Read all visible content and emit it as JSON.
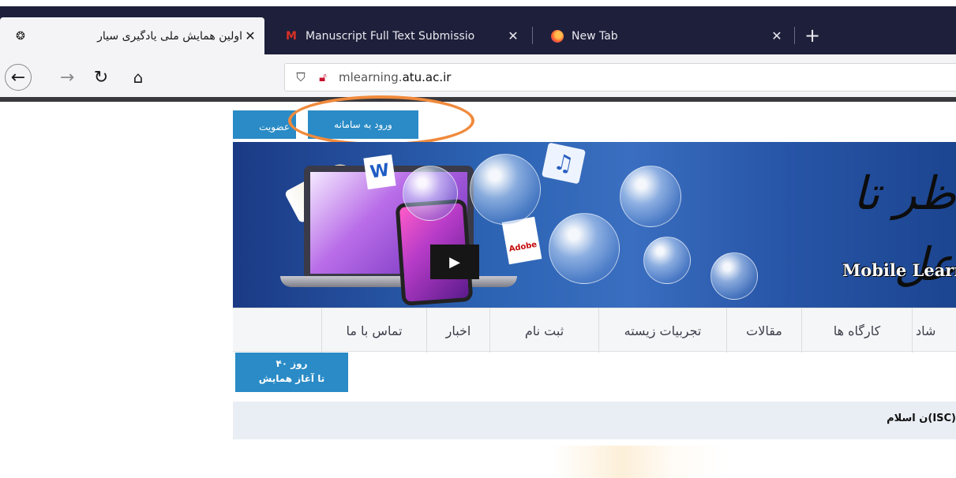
{
  "browser": {
    "tabs": [
      {
        "title": "اولین همایش ملی یادگیری سیار",
        "active": true,
        "favicon": "site-emblem-icon"
      },
      {
        "title": "Manuscript Full Text Submissio",
        "active": false,
        "favicon": "gmail-icon"
      },
      {
        "title": "New Tab",
        "active": false,
        "favicon": "firefox-icon"
      }
    ],
    "url_prefix": "mlearning.",
    "url_domain": "atu.ac.ir"
  },
  "site": {
    "membership_button": "عضویت",
    "login_button": "ورود به سامانه",
    "banner_logo_fa": "ظر تا عل",
    "banner_logo_en": "Mobile Learni",
    "menu": [
      "تماس با ما",
      "اخبار",
      "ثبت نام",
      "تجربیات زیسته",
      "مقالات",
      "کارگاه ها",
      "شاد"
    ],
    "countdown_days": "۴۰ روز",
    "countdown_label": "تا آغاز همایش",
    "strip_text": "ن اسلام(ISC)"
  },
  "colors": {
    "accent_blue": "#2a8bc6",
    "highlight_circle": "#f08a3c",
    "tabbar": "#1e1f3a"
  }
}
